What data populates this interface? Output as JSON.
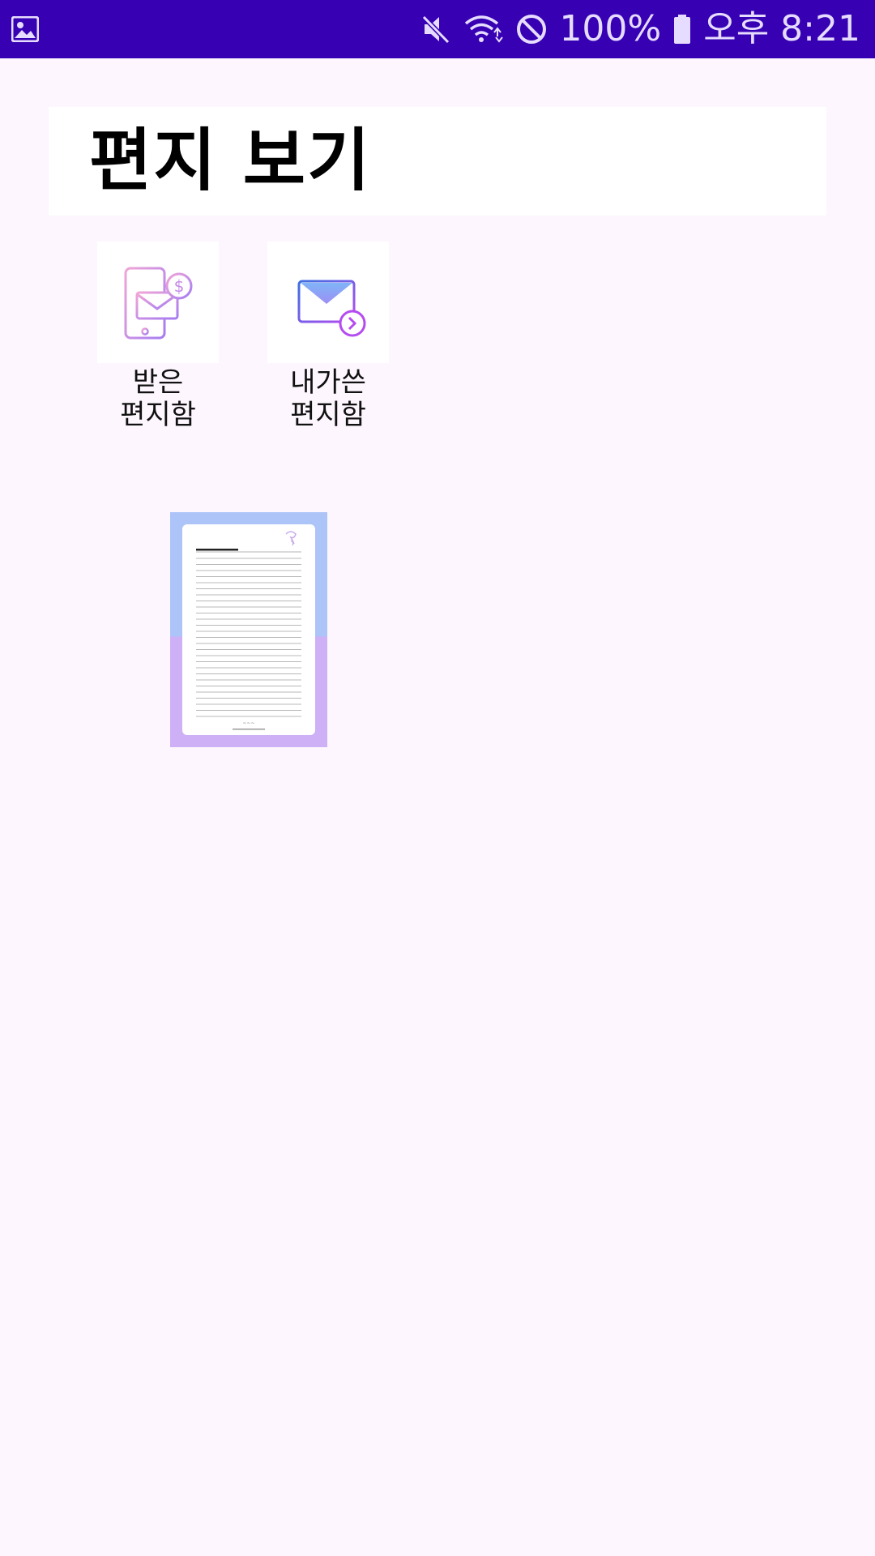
{
  "status_bar": {
    "left_icon": "image-icon",
    "icons": [
      "mute-icon",
      "wifi-icon",
      "do-not-disturb-icon",
      "battery-icon"
    ],
    "battery": "100%",
    "time": "오후 8:21"
  },
  "header": {
    "title": "편지 보기"
  },
  "menu": [
    {
      "label": "받은\n편지함",
      "icon": "mailbox-phone-icon"
    },
    {
      "label": "내가쓴\n편지함",
      "icon": "send-mail-icon"
    }
  ],
  "letters": [
    {
      "icon": "letter-paper-thumbnail"
    }
  ],
  "colors": {
    "status_bar": "#3700b3",
    "background": "#fdf6fe",
    "accent_purple": "#a64cf0"
  }
}
